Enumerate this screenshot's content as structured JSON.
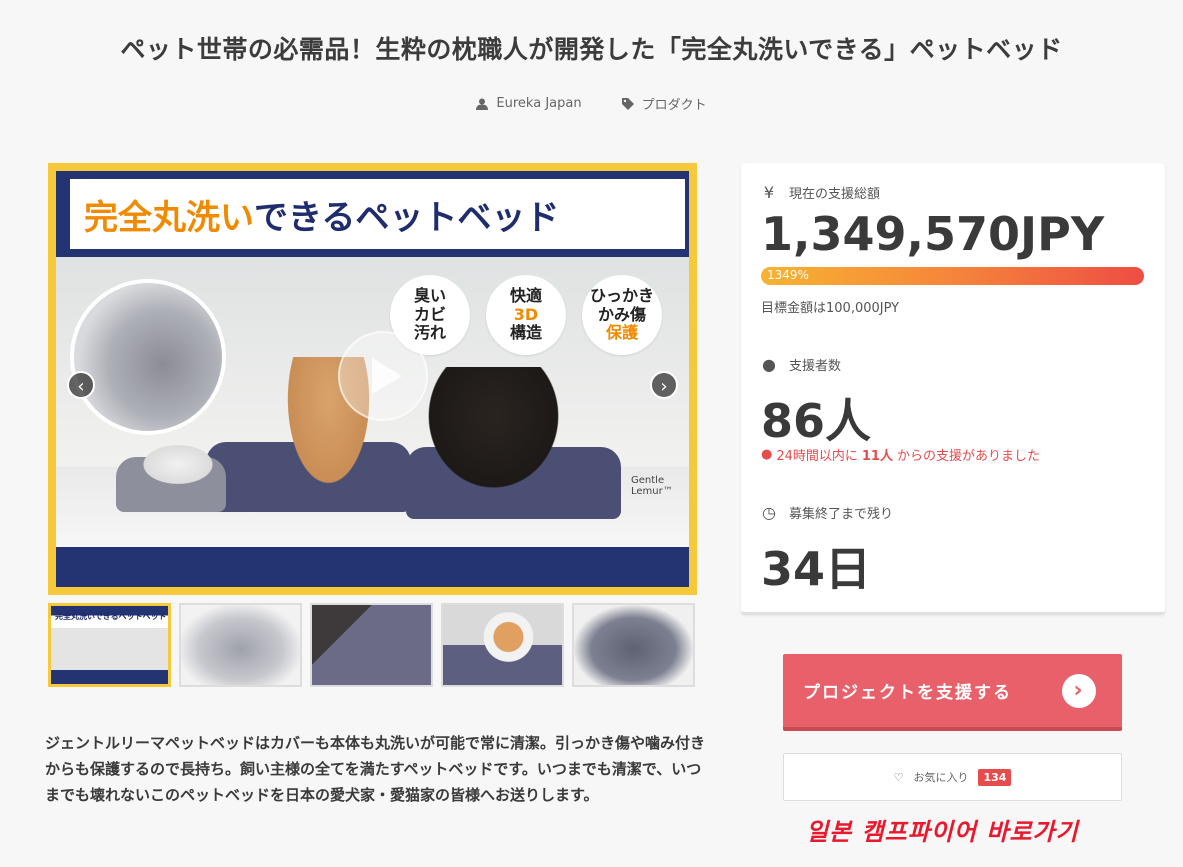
{
  "header": {
    "title": "ペット世帯の必需品！生粋の枕職人が開発した「完全丸洗いできる」ペットベッド",
    "author": "Eureka Japan",
    "category": "プロダクト"
  },
  "hero": {
    "banner_main": "完全丸洗い",
    "banner_rest": "できるペットベッド",
    "badges": [
      {
        "line1": "臭い",
        "line2": "カビ",
        "line3": "汚れ"
      },
      {
        "line1": "快適",
        "line2": "3D",
        "line3": "構造"
      },
      {
        "line1": "ひっかき",
        "line2": "かみ傷",
        "line3": "保護"
      }
    ],
    "brand": "Gentle Lemur™",
    "prev_icon": "‹",
    "next_icon": "›"
  },
  "thumbnails": {
    "first_caption": "完全丸洗いできるペットベッド"
  },
  "description": "ジェントルリーマペットベッドはカバーも本体も丸洗いが可能で常に清潔。引っかき傷や噛み付きからも保護するので長持ち。飼い主様の全てを満たすペットベッドです。いつまでも清潔で、いつまでも壊れないこのペットベッドを日本の愛犬家・愛猫家の皆様へお送りします。",
  "stats": {
    "total_label": "現在の支援総額",
    "total_value": "1,349,570JPY",
    "progress_label": "1349%",
    "progress_percent": 1349,
    "goal_text": "目標金額は100,000JPY",
    "supporters_label": "支援者数",
    "supporters_value": "86人",
    "alert_prefix": "24時間以内に",
    "alert_count": "11人",
    "alert_suffix": "からの支援がありました",
    "remaining_label": "募集終了まで残り",
    "remaining_value": "34日",
    "yen_icon": "¥"
  },
  "actions": {
    "support_label": "プロジェクトを支援する",
    "favorite_label": "お気に入り",
    "favorite_count": "134"
  },
  "overlay": {
    "korean_link": "일본 캠프파이어 바로가기"
  },
  "colors": {
    "accent": "#e8606a",
    "banner": "#243472",
    "frame": "#f5c93a",
    "alert": "#e74c4c"
  }
}
